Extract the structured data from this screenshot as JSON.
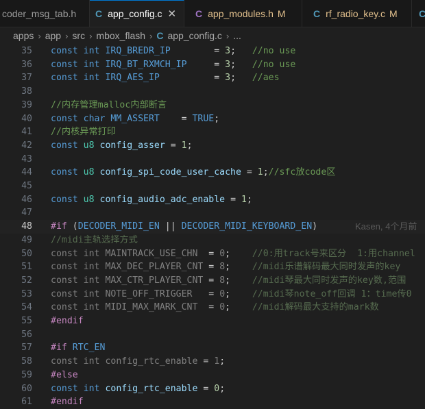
{
  "tabs": [
    {
      "label": "coder_msg_tab.h",
      "icon": "",
      "modified": ""
    },
    {
      "label": "app_config.c",
      "icon": "C",
      "modified": "",
      "close": "✕"
    },
    {
      "label": "app_modules.h",
      "icon": "C",
      "modified": "M"
    },
    {
      "label": "rf_radio_key.c",
      "icon": "C",
      "modified": "M"
    },
    {
      "label": "",
      "icon": "C",
      "modified": ""
    }
  ],
  "breadcrumb": {
    "items": [
      "apps",
      "app",
      "src",
      "mbox_flash"
    ],
    "file": "app_config.c",
    "more": "..."
  },
  "editor": {
    "current_line": 48,
    "blame": "Kasen, 4个月前",
    "lines": [
      {
        "n": "35",
        "code": "const int IRQ_BREDR_IP        = 3;   //no use"
      },
      {
        "n": "36",
        "code": "const int IRQ_BT_RXMCH_IP     = 3;   //no use"
      },
      {
        "n": "37",
        "code": "const int IRQ_AES_IP          = 3;   //aes"
      },
      {
        "n": "38",
        "code": ""
      },
      {
        "n": "39",
        "code": "//内存管理malloc内部断言"
      },
      {
        "n": "40",
        "code": "const char MM_ASSERT    = TRUE;"
      },
      {
        "n": "41",
        "code": "//内核异常打印"
      },
      {
        "n": "42",
        "code": "const u8 config_asser = 1;"
      },
      {
        "n": "43",
        "code": ""
      },
      {
        "n": "44",
        "code": "const u8 config_spi_code_user_cache = 1;//sfc放code区"
      },
      {
        "n": "45",
        "code": ""
      },
      {
        "n": "46",
        "code": "const u8 config_audio_adc_enable = 1;"
      },
      {
        "n": "47",
        "code": ""
      },
      {
        "n": "48",
        "code": "#if (DECODER_MIDI_EN || DECODER_MIDI_KEYBOARD_EN)"
      },
      {
        "n": "49",
        "code": "//midi主轨选择方式"
      },
      {
        "n": "50",
        "code": "const int MAINTRACK_USE_CHN  = 0;    //0:用track号来区分  1:用channel"
      },
      {
        "n": "51",
        "code": "const int MAX_DEC_PLAYER_CNT = 8;    //midi乐谱解码最大同时发声的key"
      },
      {
        "n": "52",
        "code": "const int MAX_CTR_PLAYER_CNT = 8;    //midi琴最大同时发声的key数,范围"
      },
      {
        "n": "53",
        "code": "const int NOTE_OFF_TRIGGER   = 0;    //midi琴note_off回调 1：time传0"
      },
      {
        "n": "54",
        "code": "const int MIDI_MAX_MARK_CNT  = 0;    //midi解码最大支持的mark数"
      },
      {
        "n": "55",
        "code": "#endif"
      },
      {
        "n": "56",
        "code": ""
      },
      {
        "n": "57",
        "code": "#if RTC_EN"
      },
      {
        "n": "58",
        "code": "const int config_rtc_enable = 1;"
      },
      {
        "n": "59",
        "code": "#else"
      },
      {
        "n": "60",
        "code": "const int config_rtc_enable = 0;"
      },
      {
        "n": "61",
        "code": "#endif"
      }
    ]
  }
}
